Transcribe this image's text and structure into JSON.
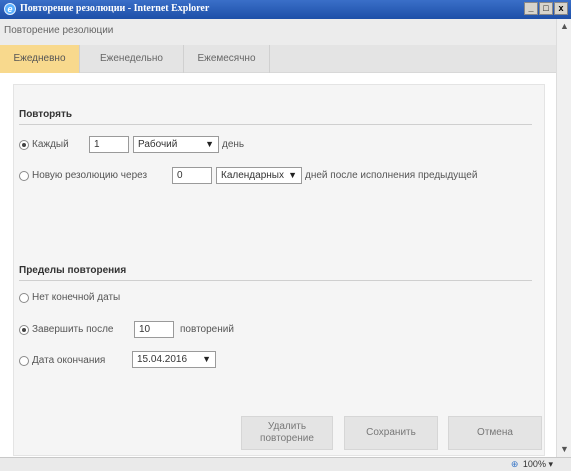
{
  "window": {
    "title": "Повторение резолюции - Internet Explorer",
    "icon": "ie-logo",
    "controls": [
      "_",
      "□",
      "x"
    ]
  },
  "dialog": {
    "title": "Повторение резолюции",
    "tabs": [
      {
        "label": "Ежедневно",
        "active": true
      },
      {
        "label": "Еженедельно",
        "active": false
      },
      {
        "label": "Ежемесячно",
        "active": false
      }
    ]
  },
  "repeat": {
    "section_title": "Повторять",
    "every": {
      "label": "Каждый",
      "checked": true,
      "value": "1",
      "day_type": "Рабочий",
      "suffix": "день"
    },
    "new_resolution": {
      "label": "Новую резолюцию через",
      "checked": false,
      "value": "0",
      "day_type": "Календарных",
      "suffix": "дней после исполнения предыдущей"
    }
  },
  "limits": {
    "section_title": "Пределы повторения",
    "no_end": {
      "label": "Нет конечной даты",
      "checked": false
    },
    "end_after": {
      "label": "Завершить после",
      "checked": true,
      "value": "10",
      "suffix": "повторений"
    },
    "end_date": {
      "label": "Дата окончания",
      "checked": false,
      "value": "15.04.2016"
    }
  },
  "buttons": {
    "delete": "Удалить\nповторение",
    "save": "Сохранить",
    "cancel": "Отмена"
  },
  "status": {
    "zoom": "100%"
  },
  "colors": {
    "active_tab": "#f8d98d",
    "titlebar": "#1d4fa8"
  }
}
